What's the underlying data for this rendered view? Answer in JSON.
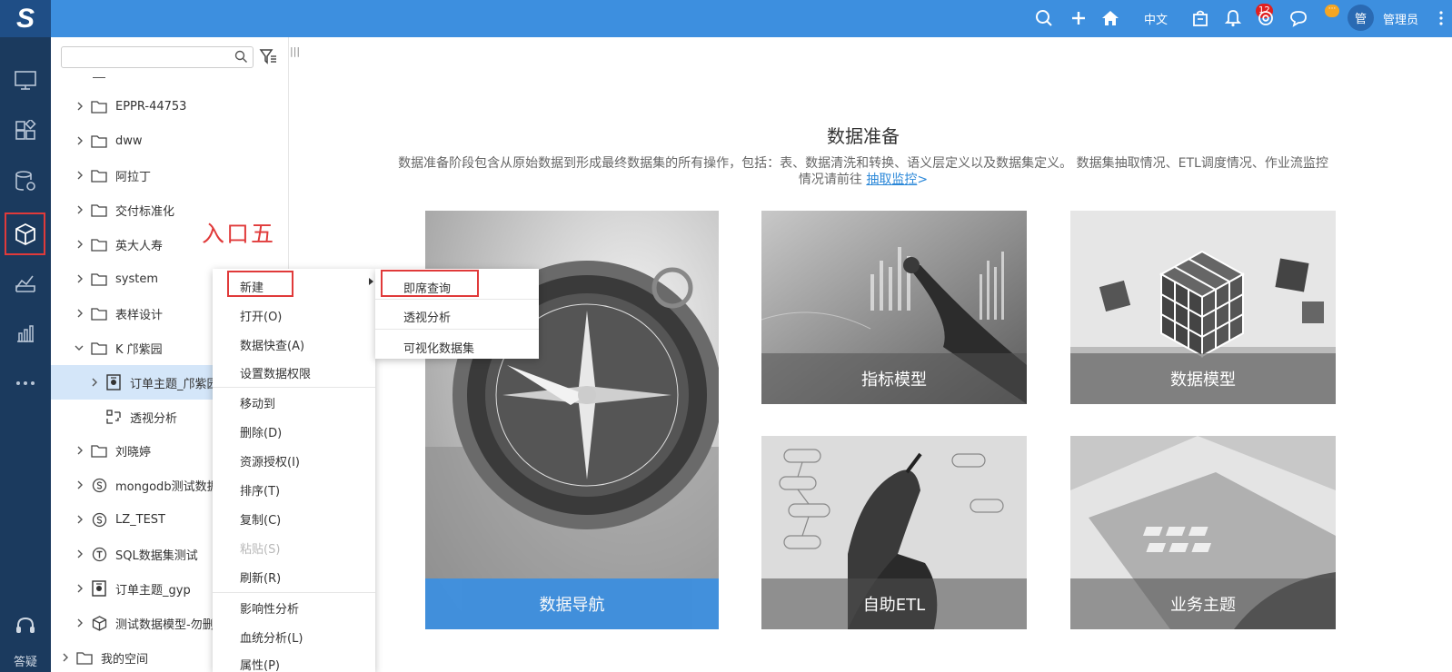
{
  "topbar": {
    "logo": "S",
    "lang": "中文",
    "notify_count": "12",
    "chat_badge": "···",
    "avatar_text": "管",
    "user_name": "管理员"
  },
  "leftnav": {
    "help_label": "答疑"
  },
  "tree": {
    "search_placeholder": "",
    "items": [
      {
        "label": "EPPR-44753"
      },
      {
        "label": "dww"
      },
      {
        "label": "阿拉丁"
      },
      {
        "label": "交付标准化"
      },
      {
        "label": "英大人寿"
      },
      {
        "label": "system"
      },
      {
        "label": "表样设计"
      },
      {
        "label": "K 邝紫园"
      },
      {
        "label": "订单主题_邝紫园"
      },
      {
        "label": "透视分析"
      },
      {
        "label": "刘晓婷"
      },
      {
        "label": "mongodb测试数据"
      },
      {
        "label": "LZ_TEST"
      },
      {
        "label": "SQL数据集测试"
      },
      {
        "label": "订单主题_gyp"
      },
      {
        "label": "测试数据模型-勿删"
      },
      {
        "label": "我的空间"
      }
    ]
  },
  "annotation": {
    "entry_label": "入口五"
  },
  "main": {
    "title": "数据准备",
    "desc_line1": "数据准备阶段包含从原始数据到形成最终数据集的所有操作，包括：表、数据清洗和转换、语义层定义以及数据集定义。 数据集抽取情况、ETL调度情况、作业流监控",
    "desc_line2": "情况请前往 ",
    "desc_link": "抽取监控",
    "desc_arrow": ">",
    "cards": [
      {
        "label": "数据导航"
      },
      {
        "label": "指标模型"
      },
      {
        "label": "数据模型"
      },
      {
        "label": "自助ETL"
      },
      {
        "label": "业务主题"
      }
    ]
  },
  "context_menu": {
    "items": [
      {
        "label": "新建"
      },
      {
        "label": "打开(O)"
      },
      {
        "label": "数据快查(A)"
      },
      {
        "label": "设置数据权限"
      },
      {
        "label": "移动到"
      },
      {
        "label": "删除(D)"
      },
      {
        "label": "资源授权(I)"
      },
      {
        "label": "排序(T)"
      },
      {
        "label": "复制(C)"
      },
      {
        "label": "粘贴(S)"
      },
      {
        "label": "刷新(R)"
      },
      {
        "label": "影响性分析"
      },
      {
        "label": "血统分析(L)"
      },
      {
        "label": "属性(P)"
      }
    ]
  },
  "submenu": {
    "items": [
      {
        "label": "即席查询"
      },
      {
        "label": "透视分析"
      },
      {
        "label": "可视化数据集"
      }
    ]
  },
  "colors": {
    "topbar": "#3d8fdf",
    "nav": "#1b3a5e",
    "highlight": "#e03a3a",
    "selected_row": "#d4e6f9",
    "nav_band": "#3d8fdf"
  }
}
